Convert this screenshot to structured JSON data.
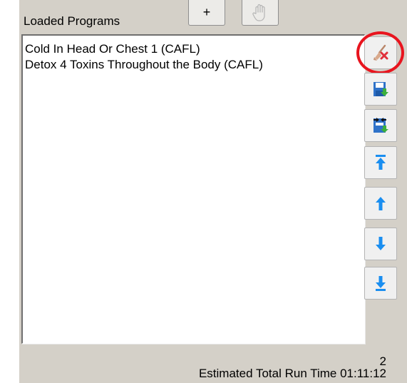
{
  "panel": {
    "title": "Loaded Programs",
    "add_button_label": "+"
  },
  "programs": [
    "Cold In Head Or Chest 1 (CAFL)",
    "Detox 4 Toxins Throughout the Body (CAFL)"
  ],
  "side_buttons": [
    {
      "icon": "clear-list-broom-icon"
    },
    {
      "icon": "save-icon"
    },
    {
      "icon": "save-as-icon"
    },
    {
      "icon": "move-to-top-icon"
    },
    {
      "icon": "move-up-icon"
    },
    {
      "icon": "move-down-icon"
    },
    {
      "icon": "move-to-bottom-icon"
    }
  ],
  "footer": {
    "program_count": "2",
    "runtime_text": "Estimated Total Run Time 01:11:12"
  },
  "colors": {
    "panel_bg": "#d4d0c8",
    "arrow_blue": "#1a8ef0",
    "save_green": "#3cb03c",
    "highlight_red": "#e8141e"
  }
}
